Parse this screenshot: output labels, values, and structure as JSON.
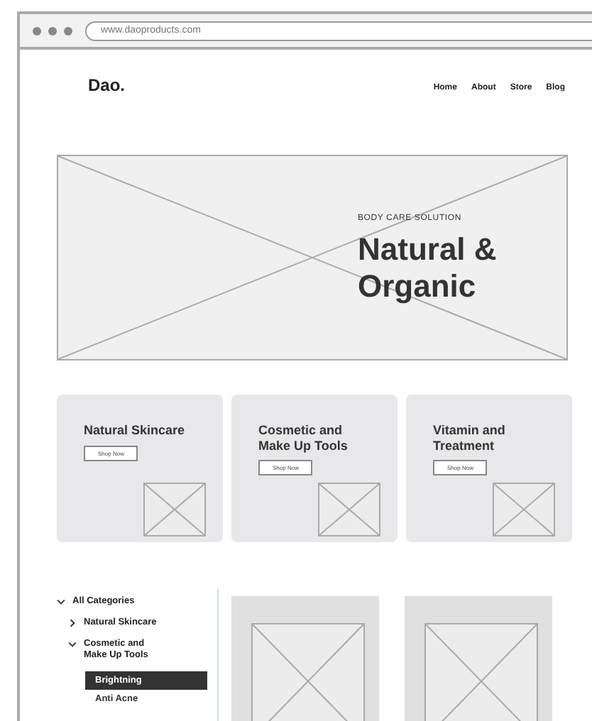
{
  "browser": {
    "url": "www.daoproducts.com"
  },
  "site": {
    "logo": "Dao.",
    "nav": [
      "Home",
      "About",
      "Store",
      "Blog"
    ]
  },
  "hero": {
    "eyebrow": "BODY CARE SOLUTION",
    "heading": "Natural & Organic"
  },
  "categories": [
    {
      "title": "Natural Skincare",
      "button": "Shop Now"
    },
    {
      "title": "Cosmetic and Make Up Tools",
      "button": "Shop Now"
    },
    {
      "title": "Vitamin and Treatment",
      "button": "Shop Now"
    }
  ],
  "sidebar": {
    "items": [
      {
        "label": "All Categories",
        "expanded": true,
        "children": [
          {
            "label": "Natural Skincare",
            "expanded": false
          },
          {
            "label": "Cosmetic and Make Up Tools",
            "expanded": true,
            "children": [
              {
                "label": "Brightning",
                "selected": true
              },
              {
                "label": "Anti Acne",
                "selected": false
              }
            ]
          }
        ]
      }
    ]
  }
}
